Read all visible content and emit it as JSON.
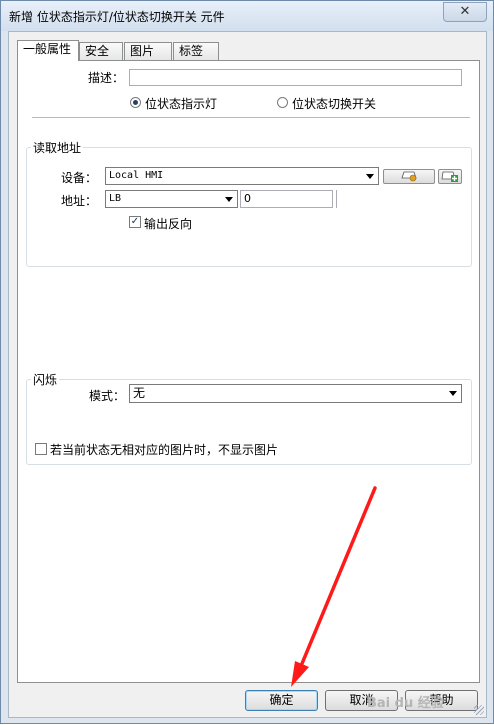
{
  "window": {
    "title": "新增 位状态指示灯/位状态切换开关 元件",
    "close_symbol": "✕"
  },
  "tabs": [
    {
      "label": "一般属性"
    },
    {
      "label": "安全"
    },
    {
      "label": "图片"
    },
    {
      "label": "标签"
    }
  ],
  "general": {
    "description_label": "描述：",
    "description_value": "",
    "radio_indicator": "位状态指示灯",
    "radio_switch": "位状态切换开关"
  },
  "read_address": {
    "group_title": "读取地址",
    "device_label": "设备：",
    "device_value": "Local HMI",
    "address_label": "地址：",
    "address_type": "LB",
    "address_value": "0",
    "invert_label": "输出反向",
    "invert_check": "✓"
  },
  "blink": {
    "group_title": "闪烁",
    "mode_label": "模式：",
    "mode_value": "无",
    "hide_label": "若当前状态无相对应的图片时，不显示图片"
  },
  "buttons": {
    "ok": "确定",
    "cancel": "取消",
    "help": "帮助"
  },
  "watermark": {
    "text": "Bai du 经验"
  },
  "colors": {
    "annotation_arrow": "#ff1a1a",
    "title_bg": "#dde6ef"
  }
}
